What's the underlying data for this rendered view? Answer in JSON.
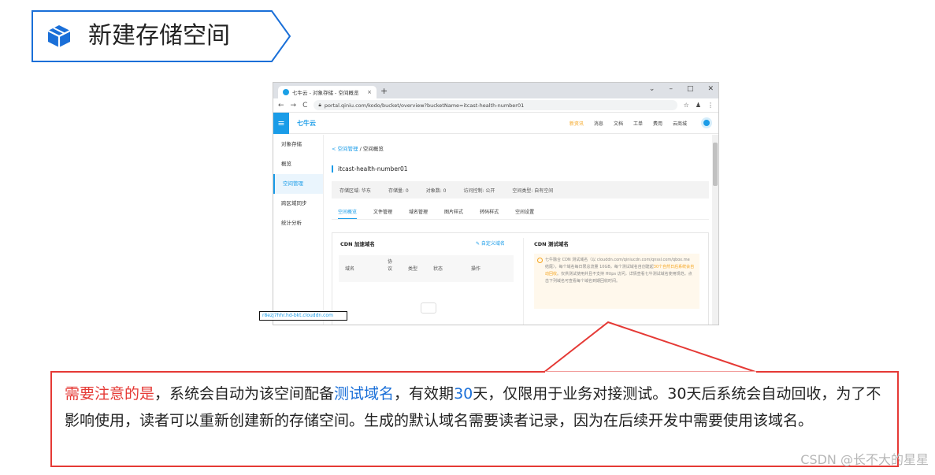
{
  "heading": {
    "title": "新建存储空间",
    "icon": "cube-icon"
  },
  "browser": {
    "tab_title": "七牛云 - 对象存储 - 空间概览",
    "tab_close": "×",
    "new_tab": "+",
    "window_controls": [
      "⌄",
      "–",
      "□",
      "✕"
    ],
    "nav": {
      "back": "←",
      "forward": "→",
      "reload": "C"
    },
    "url": "portal.qiniu.com/kodo/bucket/overview?bucketName=itcast-health-number01",
    "right_buttons": [
      "☆",
      "♟",
      "⋮"
    ]
  },
  "app": {
    "logo": "七牛云",
    "topnav": [
      "新资讯",
      "消息",
      "文档",
      "工单",
      "费用",
      "云商城"
    ],
    "sidebar": [
      "对象存储",
      "概览",
      "空间管理",
      "跨区域同步",
      "统计分析"
    ],
    "active_sidebar": "空间管理",
    "breadcrumb": {
      "link": "< 空间管理",
      "sep": "/",
      "current": "空间概览"
    },
    "bucket_name": "itcast-health-number01",
    "info": [
      "存储区域:  华东",
      "存储量:  0",
      "对象数:  0",
      "访问控制:  公开",
      "空间类型:  自有空间"
    ],
    "tabs": [
      "空间概览",
      "文件管理",
      "域名管理",
      "图片样式",
      "转码样式",
      "空间设置"
    ],
    "active_tab": "空间概览",
    "cdn_left_title": "CDN 加速域名",
    "cdn_left_link": "✎ 自定义域名",
    "table_headers": [
      "域名",
      "协议",
      "类型",
      "状态",
      "操作"
    ],
    "cdn_right_title": "CDN 测试域名",
    "notice_text_1": "七牛融合 CDN 测试域名（以 clouddn.com/qiniucdn.com/qnssl.com/qbox.me 结尾），每个域名每日限总流量 10GB，每个测试域名自创建起",
    "notice_highlight": "30个自然日后系统会自动回收",
    "notice_text_2": "。仅供测试使用并且不支持 Https 访问，详情查看七牛测试域名使用规范。点击下列域名可查看每个域名到期回收时间。",
    "test_domain": "r8ezj7hhr.hd-bkt.clouddn.com"
  },
  "callout": {
    "p1": "需要注意的是",
    "p2": "，系统会自动为该空间配备",
    "p3": "测试域名",
    "p4": "，有效期",
    "p5": "30",
    "p6": "天，仅限用于业务对接测试。30天后系统会自动回收，为了不影响使用，读者可以重新创建新的存储空间。生成的默认域名需要读者记录，因为在后续开发中需要使用该域名。"
  },
  "watermark": "CSDN @长不大的星星",
  "colors": {
    "accent": "#1a9ce8",
    "callout_red": "#e53935",
    "heading_border": "#1a6fd8"
  }
}
